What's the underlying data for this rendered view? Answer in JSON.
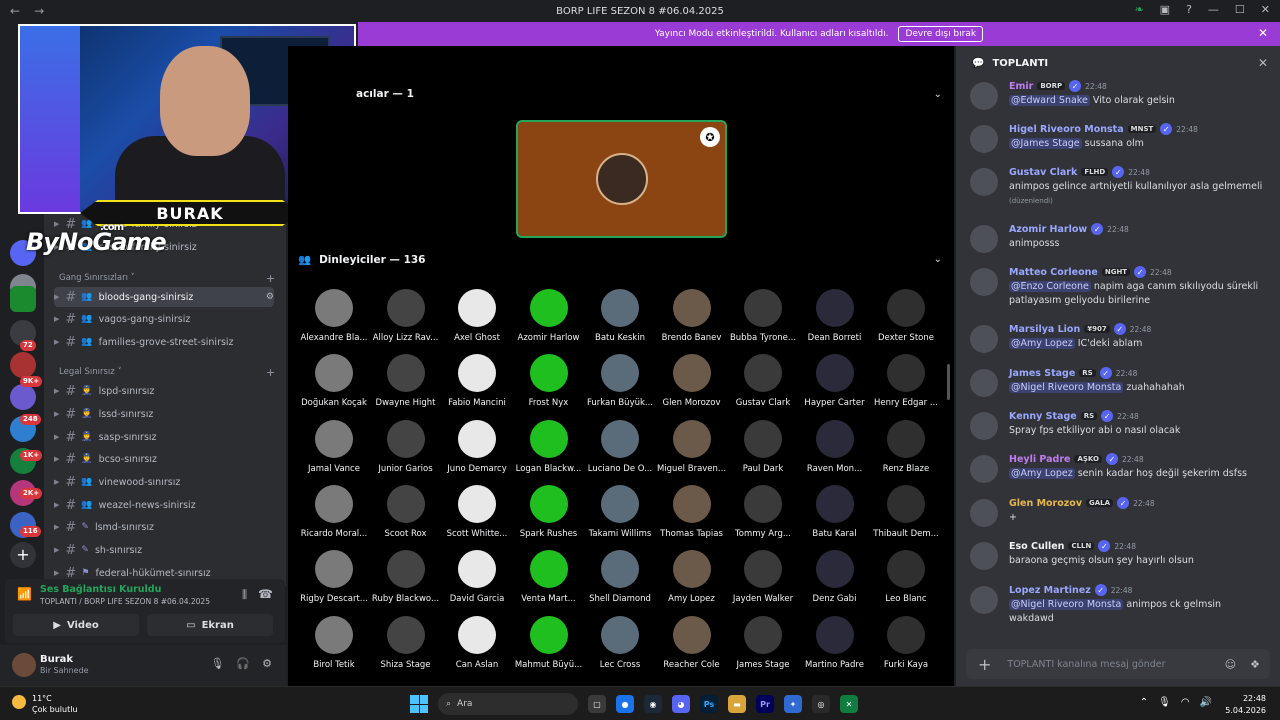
{
  "window": {
    "title": "BORP LIFE SEZON 8 #06.04.2025"
  },
  "banner": {
    "text": "Yayıncı Modu etkinleştirildi. Kullanıcı adları kısaltıldı.",
    "button": "Devre dışı bırak"
  },
  "guild_badges": [
    "72",
    "9K+",
    "248",
    "1K+",
    "2K+",
    "116"
  ],
  "stream_overlay": {
    "name": "BURAK",
    "watermark": "ByNoGame",
    "watermark_domain": ".com"
  },
  "channels": {
    "top": [
      {
        "name": "castro-family-sinirsiz"
      },
      {
        "name": "castro-family-sinirsiz"
      }
    ],
    "categories": [
      {
        "title": "Gang Sınırsızları",
        "items": [
          "bloods-gang-sinirsiz",
          "vagos-gang-sinirsiz",
          "families-grove-street-sinirsiz"
        ]
      },
      {
        "title": "Legal Sınırsız",
        "items": [
          "lspd-sınırsız",
          "lssd-sınırsız",
          "sasp-sınırsız",
          "bcso-sınırsız",
          "vinewood-sınırsız",
          "weazel-news-sinirsiz",
          "lsmd-sınırsız",
          "sh-sınırsız",
          "federal-hükümet-sınırsız"
        ]
      }
    ]
  },
  "voice": {
    "status": "Ses Bağlantısı Kuruldu",
    "location": "TOPLANTI / BORP LIFE SEZON 8 #06.04.2025",
    "video_label": "Video",
    "screen_label": "Ekran"
  },
  "user": {
    "name": "Burak",
    "status": "Bir Sahnede"
  },
  "stage": {
    "speakers_header": "acılar — 1",
    "listeners_header": "Dinleyiciler — 136",
    "listeners": [
      "Alexandre Bla...",
      "Alloy Lizz Rav...",
      "Axel Ghost",
      "Azomir Harlow",
      "Batu Keskin",
      "Brendo Banev",
      "Bubba Tyrone...",
      "Dean Borreti",
      "Dexter Stone",
      "Doğukan Koçak",
      "Dwayne Hight",
      "Fabio Mancini",
      "Frost Nyx",
      "Furkan Büyük...",
      "Glen Morozov",
      "Gustav Clark",
      "Hayper Carter",
      "Henry Edgar ...",
      "Jamal Vance",
      "Junior Garios",
      "Juno Demarcy",
      "Logan Blackw...",
      "Luciano De O...",
      "Miguel Braven...",
      "Paul Dark",
      "Raven Mon...",
      "Renz Blaze",
      "Ricardo Moral...",
      "Scoot Rox",
      "Scott Whitte...",
      "Spark Rushes",
      "Takami Willims",
      "Thomas Tapias",
      "Tommy Arg...",
      "Batu Karal",
      "Thibault Dem...",
      "Rigby Descart...",
      "Ruby Blackwo...",
      "David Garcia",
      "Venta Mart...",
      "Shell Diamond",
      "Amy Lopez",
      "Jayden Walker",
      "Denz Gabi",
      "Leo Blanc",
      "Birol Tetik",
      "Shiza Stage",
      "Can Aslan",
      "Mahmut Büyü...",
      "Lec Cross",
      "Reacher Cole",
      "James Stage",
      "Martino Padre",
      "Furki Kaya"
    ]
  },
  "chat": {
    "title": "TOPLANTI",
    "input_placeholder": "TOPLANTI kanalına mesaj gönder",
    "messages": [
      {
        "user": "Emir",
        "tag": "BORP",
        "time": "22:48",
        "color": "#c27cf1",
        "mention": "@Edward Snake",
        "text": " Vito olarak gelsin"
      },
      {
        "user": "Higel Riveoro Monsta",
        "tag": "MNST",
        "time": "22:48",
        "color": "#9aa7ff",
        "mention": "@James Stage",
        "text": " sussana olm"
      },
      {
        "user": "Gustav Clark",
        "tag": "FLHD",
        "time": "22:48",
        "color": "#9aa7ff",
        "mention": "",
        "text": "animpos gelince artniyetli kullanılıyor asla gelmemeli",
        "edited": "(düzenlendi)"
      },
      {
        "user": "Azomir Harlow",
        "tag": "",
        "time": "22:48",
        "color": "#9aa7ff",
        "mention": "",
        "text": "animposss"
      },
      {
        "user": "Matteo Corleone",
        "tag": "NGHT",
        "time": "22:48",
        "color": "#9aa7ff",
        "mention": "@Enzo Corleone",
        "text": " napim aga canım sıkılıyodu sürekli patlayasım geliyodu birilerine"
      },
      {
        "user": "Marsilya Lion",
        "tag": "¥907",
        "time": "22:48",
        "color": "#9aa7ff",
        "mention": "@Amy Lopez",
        "text": " IC'deki ablam"
      },
      {
        "user": "James Stage",
        "tag": "RS",
        "time": "22:48",
        "color": "#9aa7ff",
        "mention": "@Nigel Riveoro Monsta",
        "text": " zuahahahah"
      },
      {
        "user": "Kenny Stage",
        "tag": "RS",
        "time": "22:48",
        "color": "#9aa7ff",
        "mention": "",
        "text": "Spray fps etkiliyor abi o nasıl olacak"
      },
      {
        "user": "Heyli Padre",
        "tag": "AŞKO",
        "time": "22:48",
        "color": "#c27cf1",
        "mention": "@Amy Lopez",
        "text": " senin kadar hoş değil şekerim dsfss"
      },
      {
        "user": "Glen Morozov",
        "tag": "GALA",
        "time": "22:48",
        "color": "#e6b84a",
        "mention": "",
        "text": "+"
      },
      {
        "user": "Eso Cullen",
        "tag": "CLLN",
        "time": "22:48",
        "color": "#f2f3f5",
        "mention": "",
        "text": "baraona geçmiş olsun şey hayırlı olsun"
      },
      {
        "user": "Lopez Martinez",
        "tag": "",
        "time": "22:48",
        "color": "#9aa7ff",
        "mention": "@Nigel Riveoro Monsta",
        "text": " animpos ck gelmsin wakdawd"
      }
    ]
  },
  "taskbar": {
    "temp": "11°C",
    "weather": "Çok bulutlu",
    "search": "Ara",
    "time": "22:48",
    "date": "5.04.2026"
  }
}
